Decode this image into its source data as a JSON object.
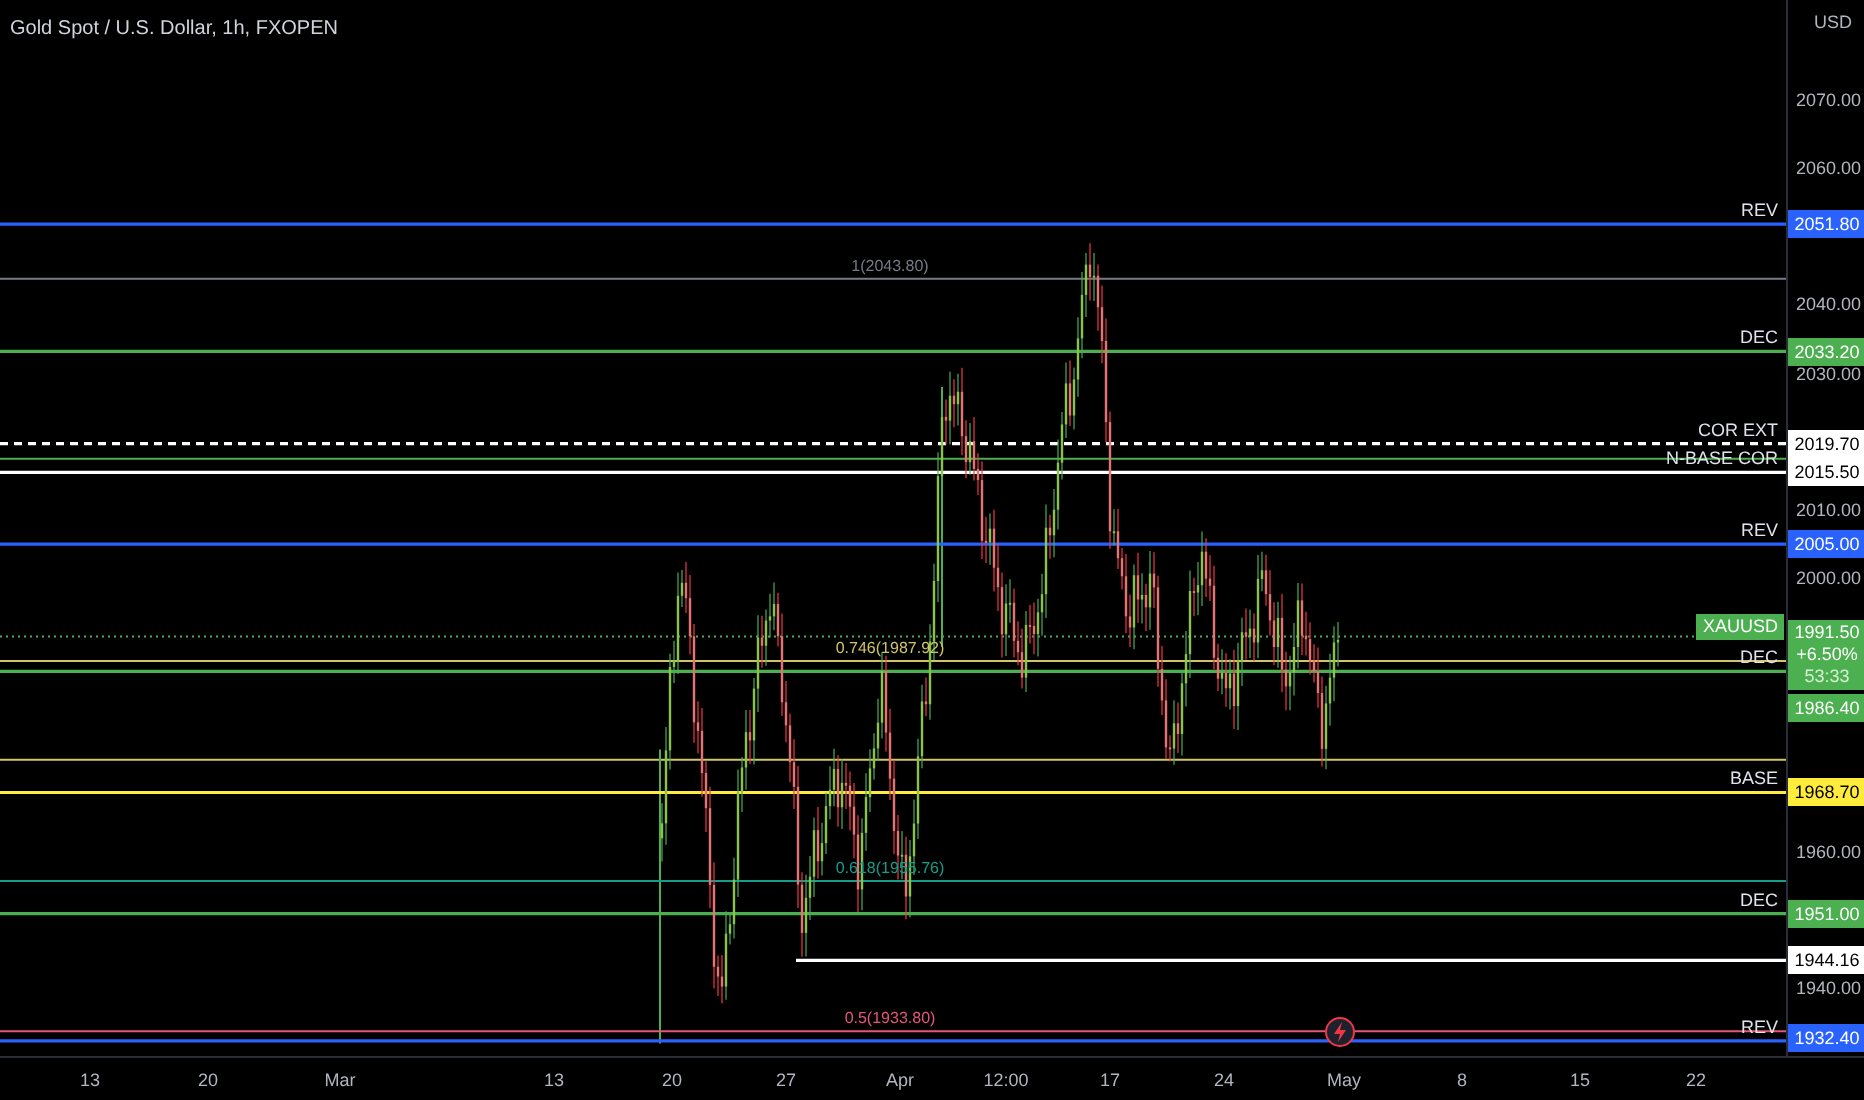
{
  "chart": {
    "title": "Gold Spot / U.S. Dollar, 1h, FXOPEN",
    "currency": "USD"
  },
  "price_ticks": [
    "2070.00",
    "2060.00",
    "2040.00",
    "2030.00",
    "2010.00",
    "2000.00",
    "1960.00",
    "1940.00"
  ],
  "time_ticks": [
    "13",
    "20",
    "Mar",
    "13",
    "20",
    "27",
    "Apr",
    "12:00",
    "17",
    "24",
    "May",
    "8",
    "15",
    "22"
  ],
  "levels": [
    {
      "kind": "solid",
      "label": "REV",
      "price": "2051.80",
      "color": "#2962ff"
    },
    {
      "kind": "fib",
      "label": "1(2043.80)",
      "color": "#787b86"
    },
    {
      "kind": "solid",
      "label": "DEC",
      "price": "2033.20",
      "color": "#4caf50"
    },
    {
      "kind": "dashed",
      "label": "COR EXT",
      "price": "2019.70",
      "color": "#ffffff"
    },
    {
      "kind": "solid",
      "label": "N-BASE COR",
      "price": "2015.50",
      "color": "#ffffff"
    },
    {
      "kind": "solid",
      "label": "REV",
      "price": "2005.00",
      "color": "#2962ff"
    },
    {
      "kind": "fib",
      "label": "0.746(1987.92)",
      "color": "#d1c56a"
    },
    {
      "kind": "solid",
      "label": "DEC",
      "price": "1986.40",
      "color": "#4caf50"
    },
    {
      "kind": "solid",
      "label": "BASE",
      "price": "1968.70",
      "color": "#ffeb3b"
    },
    {
      "kind": "fib",
      "label": "0.618(1955.76)",
      "color": "#159d8c"
    },
    {
      "kind": "solid",
      "label": "DEC",
      "price": "1951.00",
      "color": "#4caf50"
    },
    {
      "kind": "solid",
      "price": "1944.16",
      "color": "#ffffff"
    },
    {
      "kind": "fib",
      "label": "0.5(1933.80)",
      "color": "#e5577a"
    },
    {
      "kind": "solid",
      "label": "REV",
      "price": "1932.40",
      "color": "#2962ff"
    }
  ],
  "ticker": {
    "symbol": "XAUUSD",
    "price": "1991.50",
    "change": "+6.50%",
    "countdown": "53:33",
    "color": "#4caf50"
  }
}
